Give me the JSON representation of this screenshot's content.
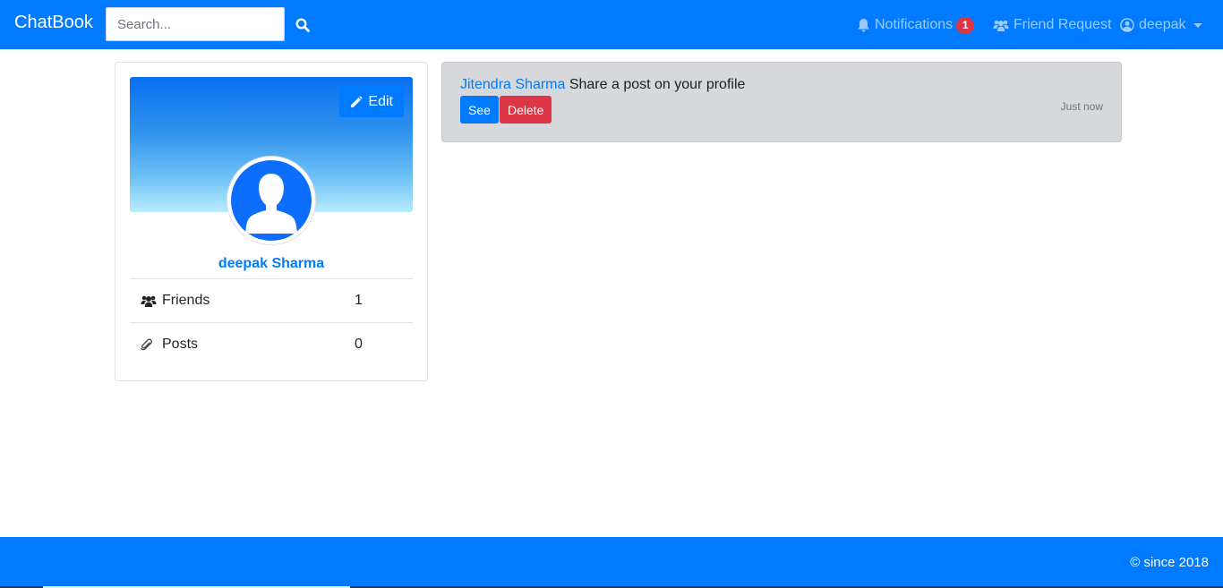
{
  "navbar": {
    "brand": "ChatBook",
    "search_placeholder": "Search...",
    "notifications_label": "Notifications",
    "notifications_count": "1",
    "friend_request_label": "Friend Request",
    "user_label": "deepak"
  },
  "profile": {
    "edit_label": "Edit",
    "name": "deepak Sharma",
    "stats": [
      {
        "label": "Friends",
        "value": "1"
      },
      {
        "label": "Posts",
        "value": "0"
      }
    ]
  },
  "notification": {
    "actor": "Jitendra Sharma",
    "message": " Share a post on your profile",
    "see_label": "See",
    "delete_label": "Delete",
    "time": "Just now"
  },
  "footer": {
    "copyright": "© since 2018"
  },
  "colors": {
    "primary": "#007bff",
    "danger": "#dc3545",
    "notification_bg": "#d6d8db"
  }
}
